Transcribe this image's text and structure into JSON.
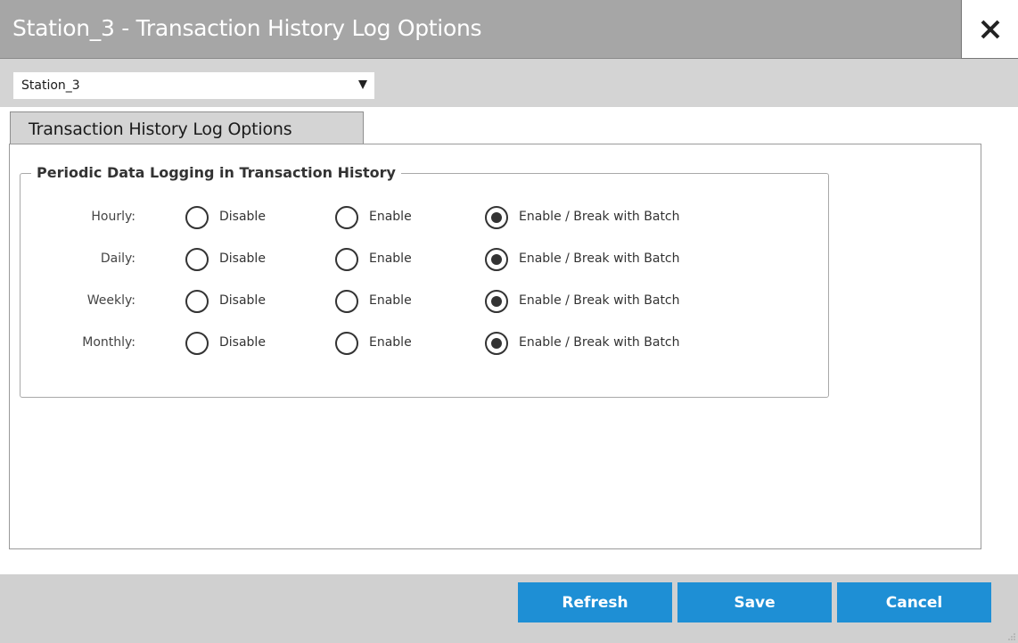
{
  "window": {
    "title": "Station_3 - Transaction History Log Options"
  },
  "station_select": {
    "value": "Station_3"
  },
  "tab": {
    "label": "Transaction History Log Options"
  },
  "group": {
    "legend": "Periodic Data Logging in Transaction History"
  },
  "options": [
    "Disable",
    "Enable",
    "Enable / Break with Batch"
  ],
  "rows": [
    {
      "label": "Hourly:",
      "selected": "Enable / Break with Batch"
    },
    {
      "label": "Daily:",
      "selected": "Enable / Break with Batch"
    },
    {
      "label": "Weekly:",
      "selected": "Enable / Break with Batch"
    },
    {
      "label": "Monthly:",
      "selected": "Enable / Break with Batch"
    }
  ],
  "buttons": {
    "refresh": "Refresh",
    "save": "Save",
    "cancel": "Cancel"
  },
  "colors": {
    "titlebar": "#a6a6a6",
    "button": "#1e8fd5",
    "strip": "#d4d4d4"
  },
  "icons": {
    "close": "close-icon",
    "dropdown": "chevron-down-icon"
  }
}
